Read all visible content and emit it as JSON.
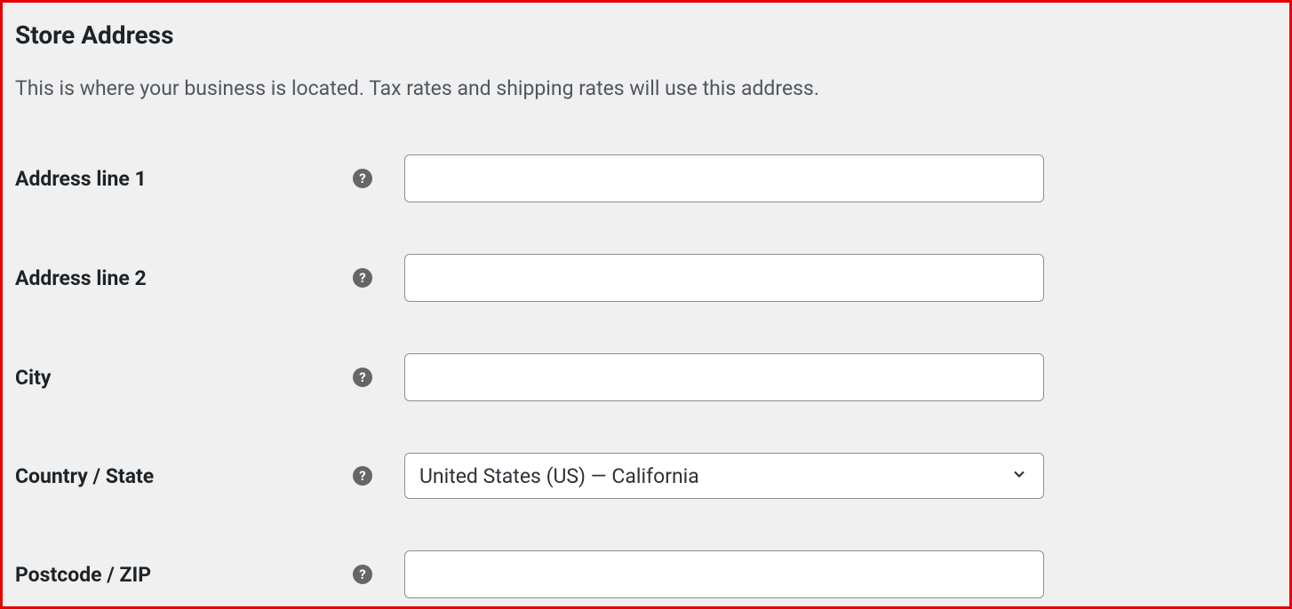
{
  "section": {
    "title": "Store Address",
    "description": "This is where your business is located. Tax rates and shipping rates will use this address."
  },
  "fields": {
    "address1": {
      "label": "Address line 1",
      "value": ""
    },
    "address2": {
      "label": "Address line 2",
      "value": ""
    },
    "city": {
      "label": "City",
      "value": ""
    },
    "country": {
      "label": "Country / State",
      "selected": "United States (US) — California"
    },
    "postcode": {
      "label": "Postcode / ZIP",
      "value": ""
    }
  },
  "help_glyph": "?"
}
